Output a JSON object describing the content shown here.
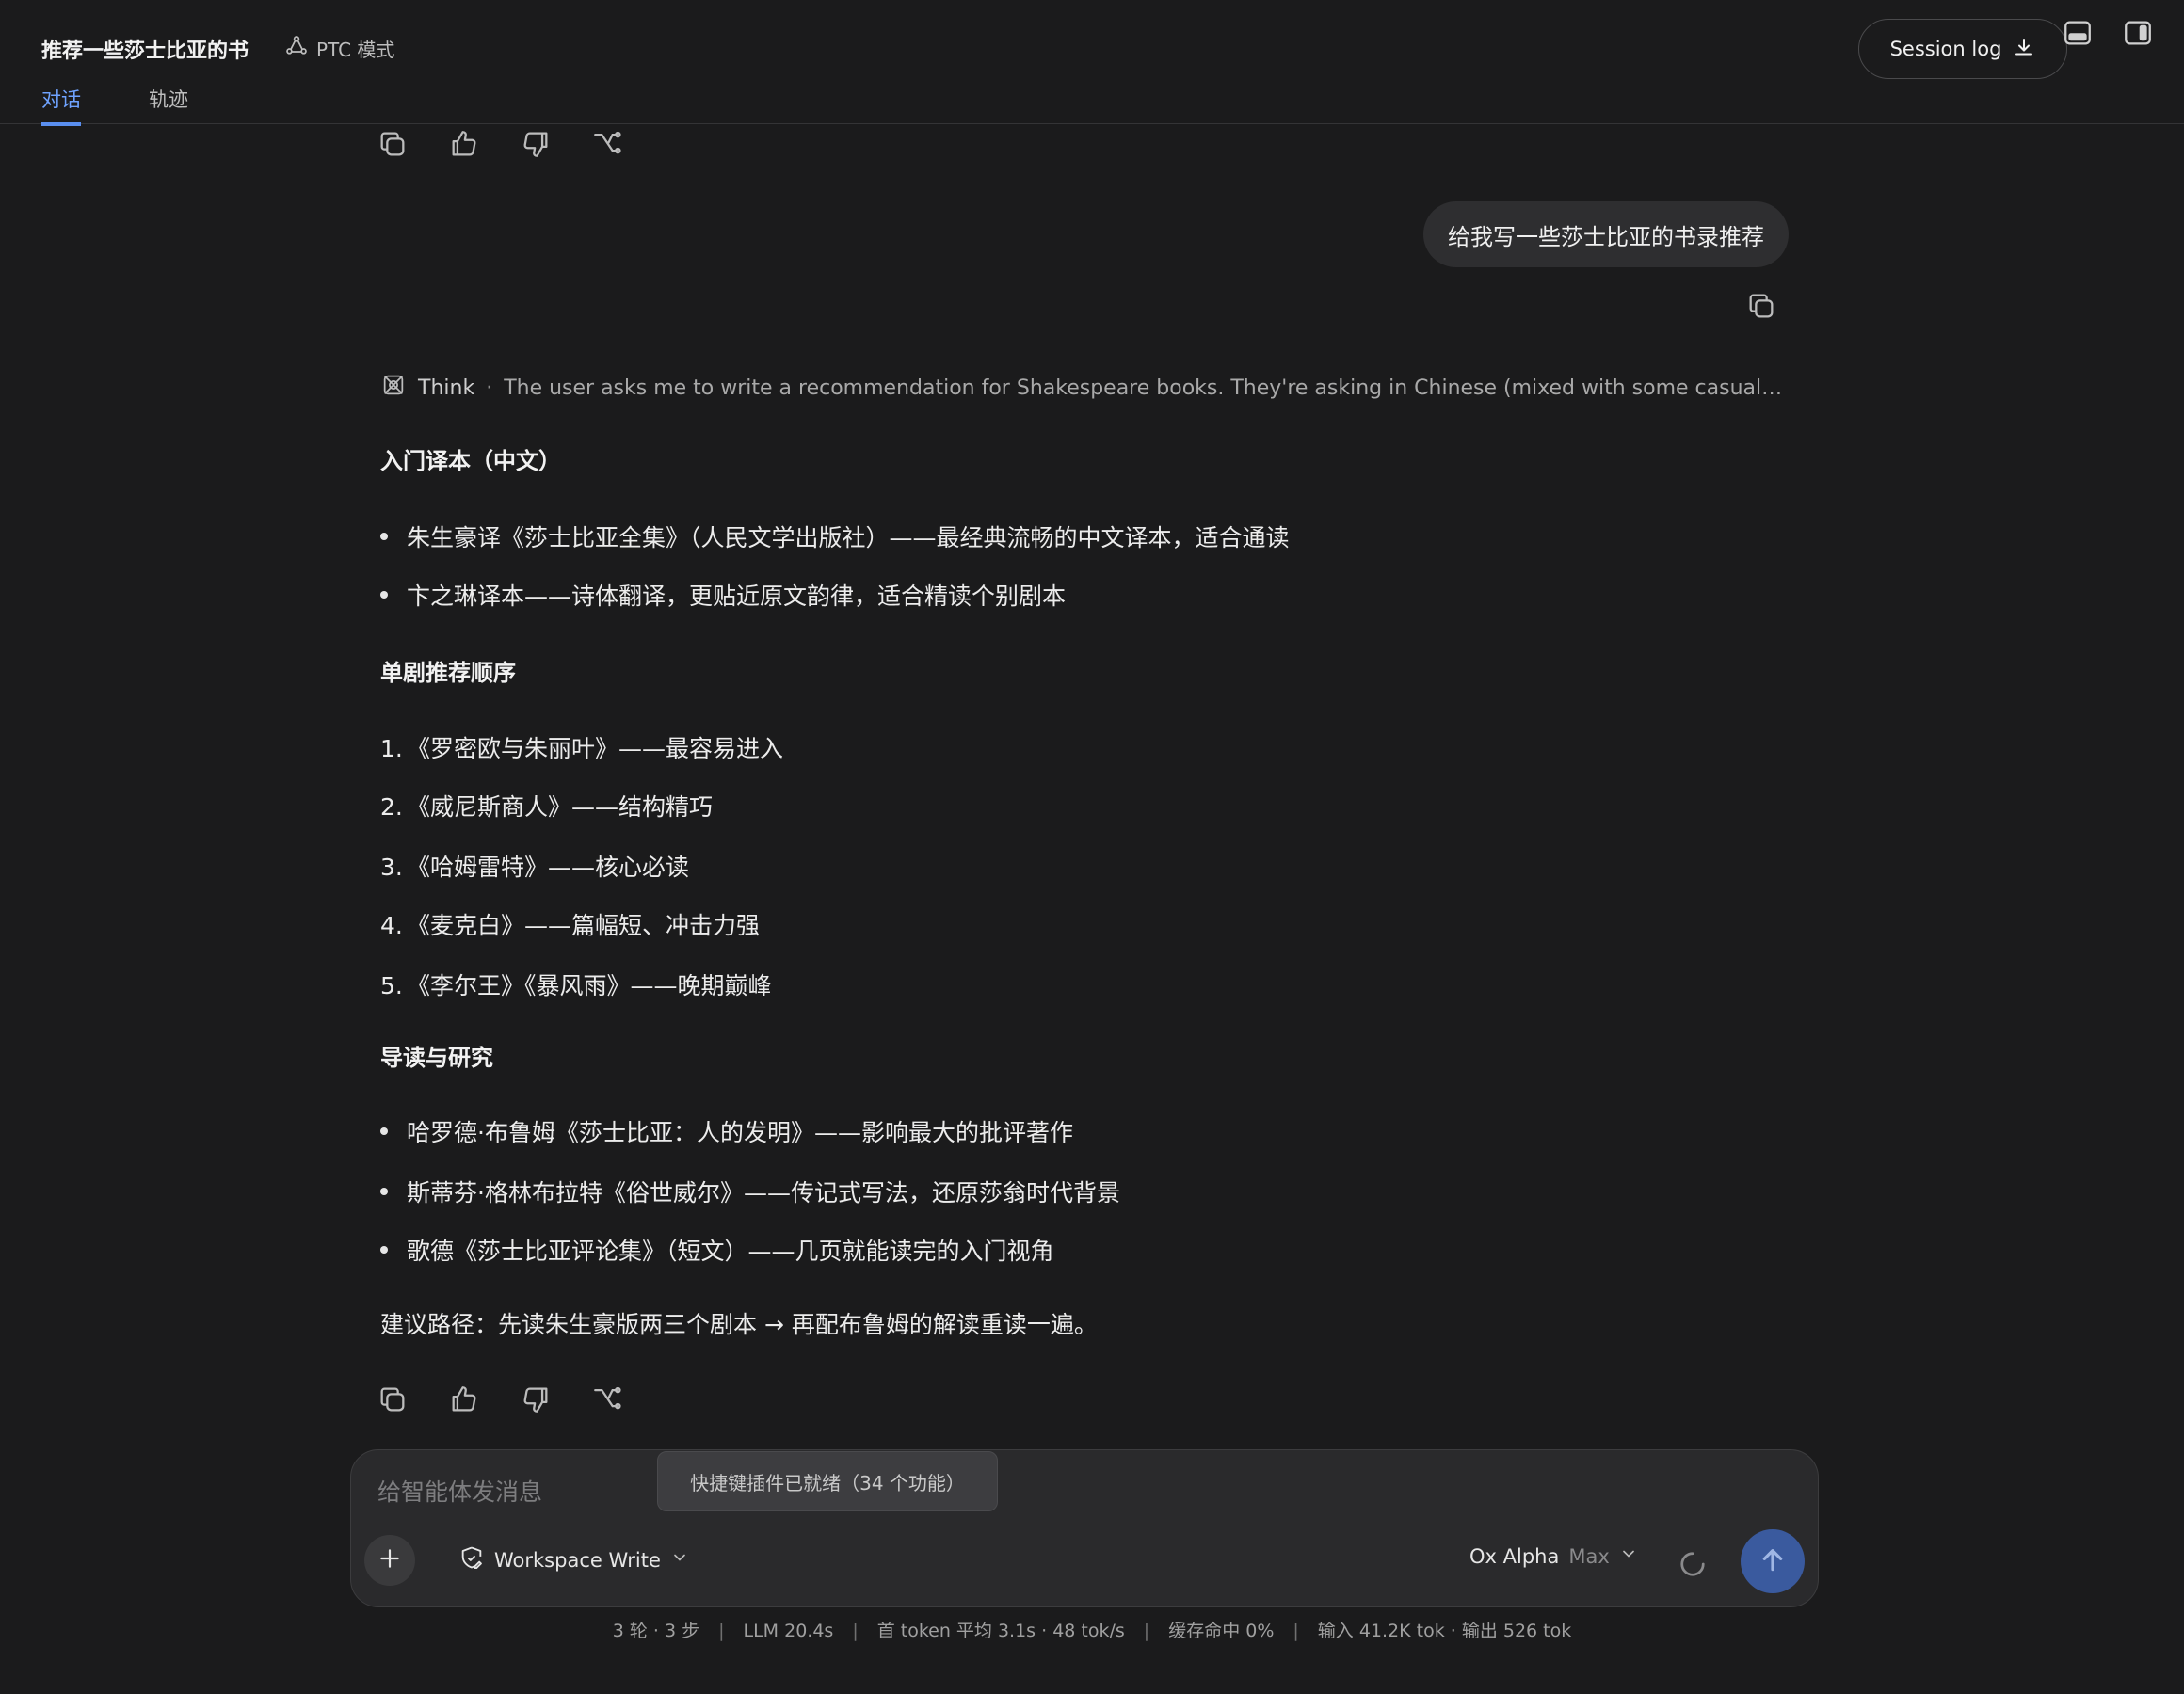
{
  "header": {
    "title": "推荐一些莎士比亚的书",
    "mode_label": "PTC 模式",
    "tabs": [
      {
        "label": "对话",
        "active": true
      },
      {
        "label": "轨迹",
        "active": false
      }
    ],
    "session_log_label": "Session log"
  },
  "user_message": "给我写一些莎士比亚的书录推荐",
  "think": {
    "label": "Think",
    "separator": "·",
    "text": "The user asks me to write a recommendation for Shakespeare books. They're asking in Chinese (mixed with some casual typi..."
  },
  "answer": {
    "section1_heading": "入门译本（中文）",
    "section1_items": [
      "朱生豪译《莎士比亚全集》（人民文学出版社）——最经典流畅的中文译本，适合通读",
      "卞之琳译本——诗体翻译，更贴近原文韵律，适合精读个别剧本"
    ],
    "section2_heading": "单剧推荐顺序",
    "section2_items": [
      {
        "num": "1.",
        "text": "《罗密欧与朱丽叶》——最容易进入"
      },
      {
        "num": "2.",
        "text": "《威尼斯商人》——结构精巧"
      },
      {
        "num": "3.",
        "text": "《哈姆雷特》——核心必读"
      },
      {
        "num": "4.",
        "text": "《麦克白》——篇幅短、冲击力强"
      },
      {
        "num": "5.",
        "text": "《李尔王》《暴风雨》——晚期巅峰"
      }
    ],
    "section3_heading": "导读与研究",
    "section3_items": [
      "哈罗德·布鲁姆《莎士比亚：人的发明》——影响最大的批评著作",
      "斯蒂芬·格林布拉特《俗世威尔》——传记式写法，还原莎翁时代背景",
      "歌德《莎士比亚评论集》（短文）——几页就能读完的入门视角"
    ],
    "conclusion": "建议路径：先读朱生豪版两三个剧本 → 再配布鲁姆的解读重读一遍。"
  },
  "composer": {
    "placeholder": "给智能体发消息",
    "value": "",
    "toast": "快捷键插件已就绪（34 个功能）",
    "permission_label": "Workspace Write",
    "model_name": "Ox Alpha",
    "model_tier": "Max"
  },
  "stats": {
    "rounds": "3 轮 · 3 步",
    "llm_time": "LLM 20.4s",
    "first_token": "首 token 平均 3.1s · 48 tok/s",
    "cache": "缓存命中 0%",
    "io": "输入 41.2K tok · 输出 526 tok",
    "separator": "|"
  },
  "icons": {
    "mode": "ptc-mode-icon",
    "download": "download-icon",
    "layout_bottom": "panel-bottom-icon",
    "layout_right": "panel-right-icon",
    "copy": "copy-icon",
    "thumbs_up": "thumbs-up-icon",
    "thumbs_down": "thumbs-down-icon",
    "branch": "branch-icon",
    "think": "think-icon",
    "plus": "plus-icon",
    "shield": "shield-edit-icon",
    "chevron": "chevron-down-icon",
    "spinner": "loading-spinner-icon",
    "send": "arrow-up-icon"
  },
  "colors": {
    "background": "#1b1b1c",
    "accent": "#5a8ff0",
    "send_button": "#3a5a9e",
    "bubble": "#2e2e30"
  }
}
